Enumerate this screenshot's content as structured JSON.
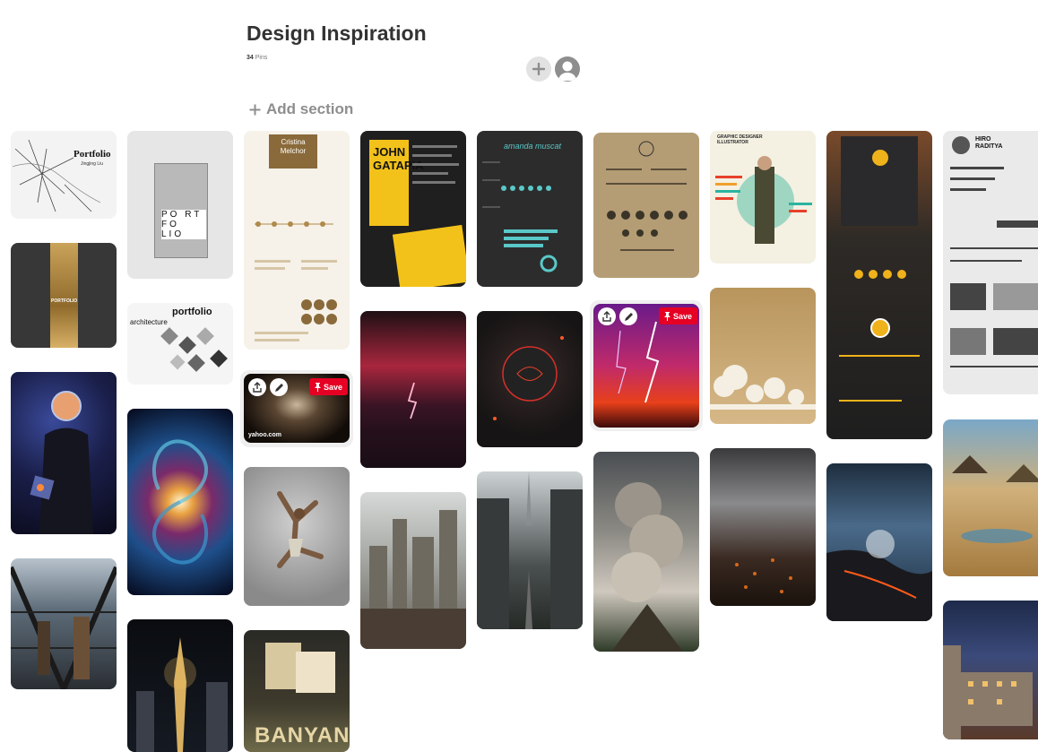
{
  "board": {
    "title": "Design Inspiration",
    "pin_count": "34",
    "pins_label": "Pins",
    "add_section_label": "Add section"
  },
  "icons": {
    "add_collaborator": "plus-icon",
    "avatar": "user-icon",
    "add_section": "plus-icon",
    "share": "share-icon",
    "edit": "pencil-icon",
    "save": "pin-icon"
  },
  "pins": {
    "portfolio_sketch": {
      "title": "Portfolio",
      "subtitle": "Jingjing Liu"
    },
    "portfolio_box": {
      "letters": "PO RT FO LIO"
    },
    "resume_cristina": {
      "name": "Cristina Melchor"
    },
    "resume_john": {
      "name": "JOHN GATAPIA"
    },
    "resume_amanda": {
      "name": "amanda muscat"
    },
    "resume_graphic": {
      "title": "GRAPHIC DESIGNER ILLUSTRATOR"
    },
    "resume_hiro": {
      "name": "HIRO RADITYA"
    },
    "portfolio_gold": {
      "title": "PORTFOLIO"
    },
    "architecture_portfolio": {
      "word1": "architecture",
      "word2": "portfolio"
    },
    "yahoo_pin": {
      "domain": "yahoo.com",
      "save_label": "Save"
    },
    "lightning_pin": {
      "save_label": "Save"
    },
    "banyan_menu": {
      "title": "BANYAN"
    }
  },
  "colors": {
    "save_red": "#e60023",
    "title_text": "#333333",
    "muted_text": "#8e8e8e"
  }
}
